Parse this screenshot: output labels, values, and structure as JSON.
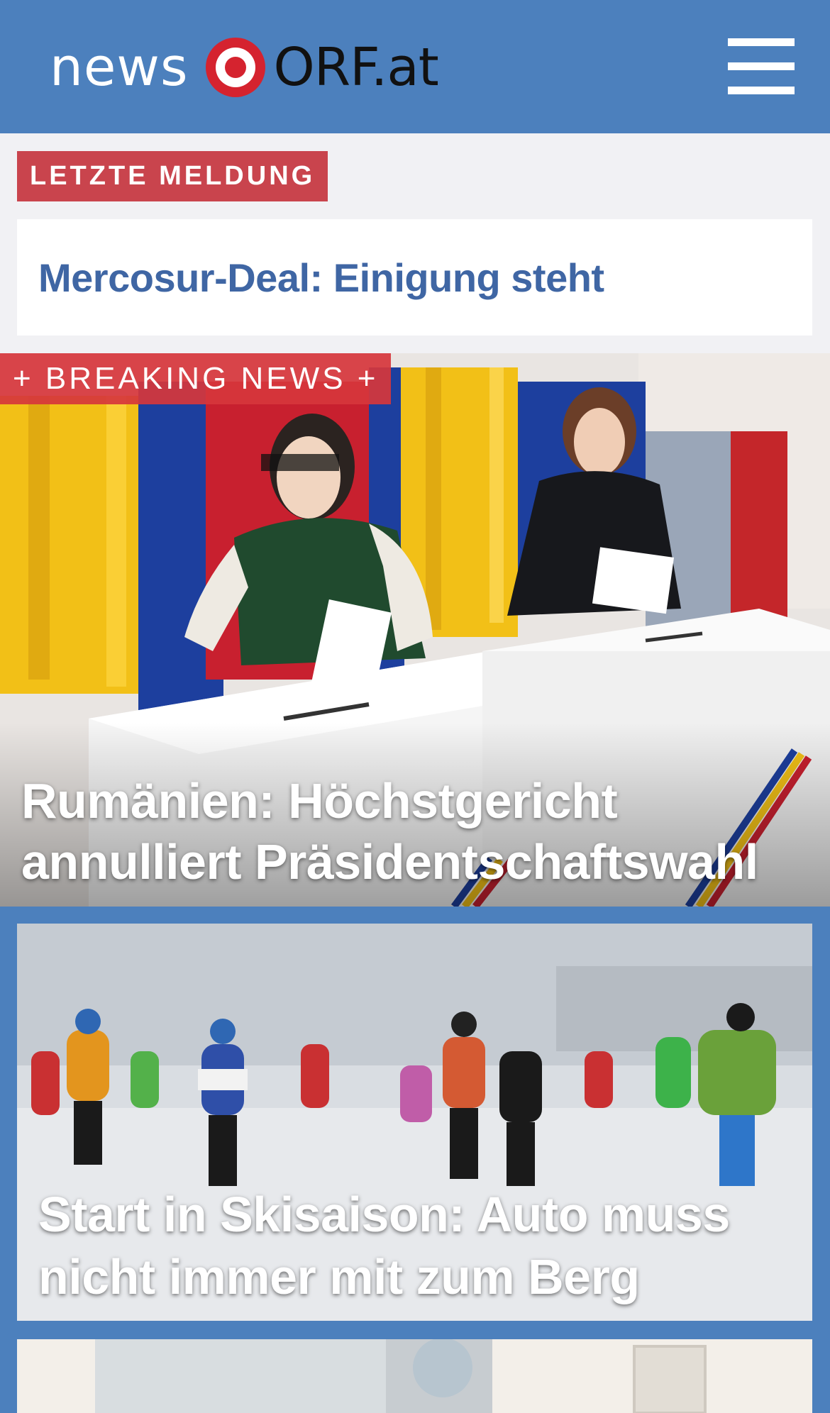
{
  "header": {
    "logo_news": "news",
    "logo_orf": "ORF.at",
    "brand_color": "#4c80bd",
    "logo_red": "#d5232f",
    "menu_icon": "hamburger-menu-icon"
  },
  "latest": {
    "label": "LETZTE MELDUNG",
    "title": "Mercosur-Deal: Einigung steht",
    "label_color": "#c9444d"
  },
  "hero": {
    "badge": "+ BREAKING NEWS +",
    "title": "Rumänien: Höchstgericht annulliert Präsidentschaftswahl"
  },
  "stories": [
    {
      "title": "Start in Skisaison: Auto muss nicht immer mit zum Berg"
    }
  ]
}
